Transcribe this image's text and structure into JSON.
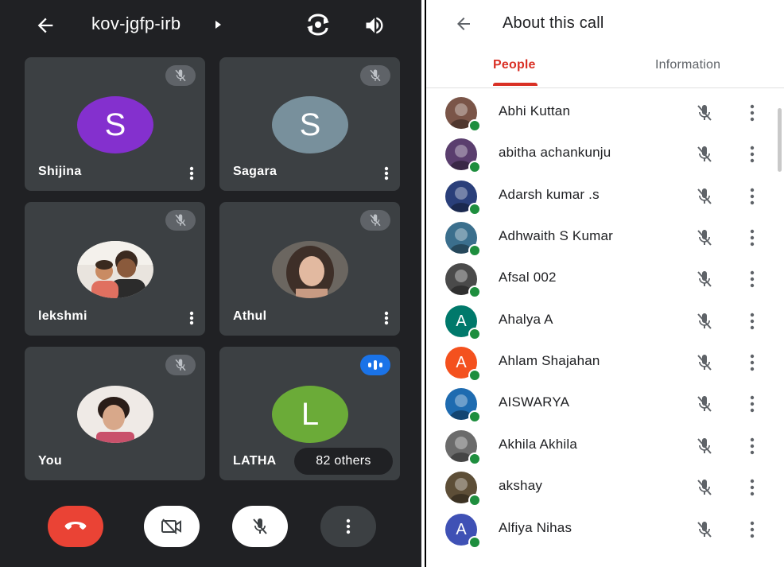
{
  "call": {
    "meeting_code": "kov-jgfp-irb",
    "tiles": [
      {
        "name": "Shijina",
        "initial": "S",
        "avatar_color": "#8430ce",
        "muted": true
      },
      {
        "name": "Sagara",
        "initial": "S",
        "avatar_color": "#78909c",
        "muted": true
      },
      {
        "name": "lekshmi",
        "initial": "",
        "muted": true,
        "photo": "family-photo"
      },
      {
        "name": "Athul",
        "initial": "",
        "muted": true,
        "photo": "woman-photo"
      },
      {
        "name": "You",
        "initial": "",
        "muted": true,
        "photo": "selfie-photo"
      },
      {
        "name": "LATHA",
        "initial": "L",
        "avatar_color": "#6bab38",
        "speaking": true
      }
    ],
    "others_label": "82 others",
    "controls": {
      "end_call_color": "#ea4335"
    }
  },
  "about": {
    "title": "About this call",
    "tabs": [
      "People",
      "Information"
    ],
    "active_tab": "People",
    "accent": "#d93025",
    "people": [
      {
        "name": "Abhi Kuttan",
        "avatar": "photo",
        "color": "#7a5548"
      },
      {
        "name": "abitha achankunju",
        "avatar": "photo",
        "color": "#5a3e6e"
      },
      {
        "name": "Adarsh kumar .s",
        "avatar": "photo",
        "color": "#2a3f7a"
      },
      {
        "name": "Adhwaith S Kumar",
        "avatar": "photo",
        "color": "#3b6f8d"
      },
      {
        "name": "Afsal 002",
        "avatar": "photo",
        "color": "#4a4a4a"
      },
      {
        "name": "Ahalya A",
        "avatar": "letter",
        "initial": "A",
        "color": "#00796b"
      },
      {
        "name": "Ahlam Shajahan",
        "avatar": "letter",
        "initial": "A",
        "color": "#f4511e"
      },
      {
        "name": "AISWARYA",
        "avatar": "photo",
        "color": "#1e6bb0"
      },
      {
        "name": "Akhila Akhila",
        "avatar": "photo",
        "color": "#6b6b6b"
      },
      {
        "name": "akshay",
        "avatar": "photo",
        "color": "#5d4e37"
      },
      {
        "name": "Alfiya Nihas",
        "avatar": "letter",
        "initial": "A",
        "color": "#3f51b5"
      }
    ]
  }
}
